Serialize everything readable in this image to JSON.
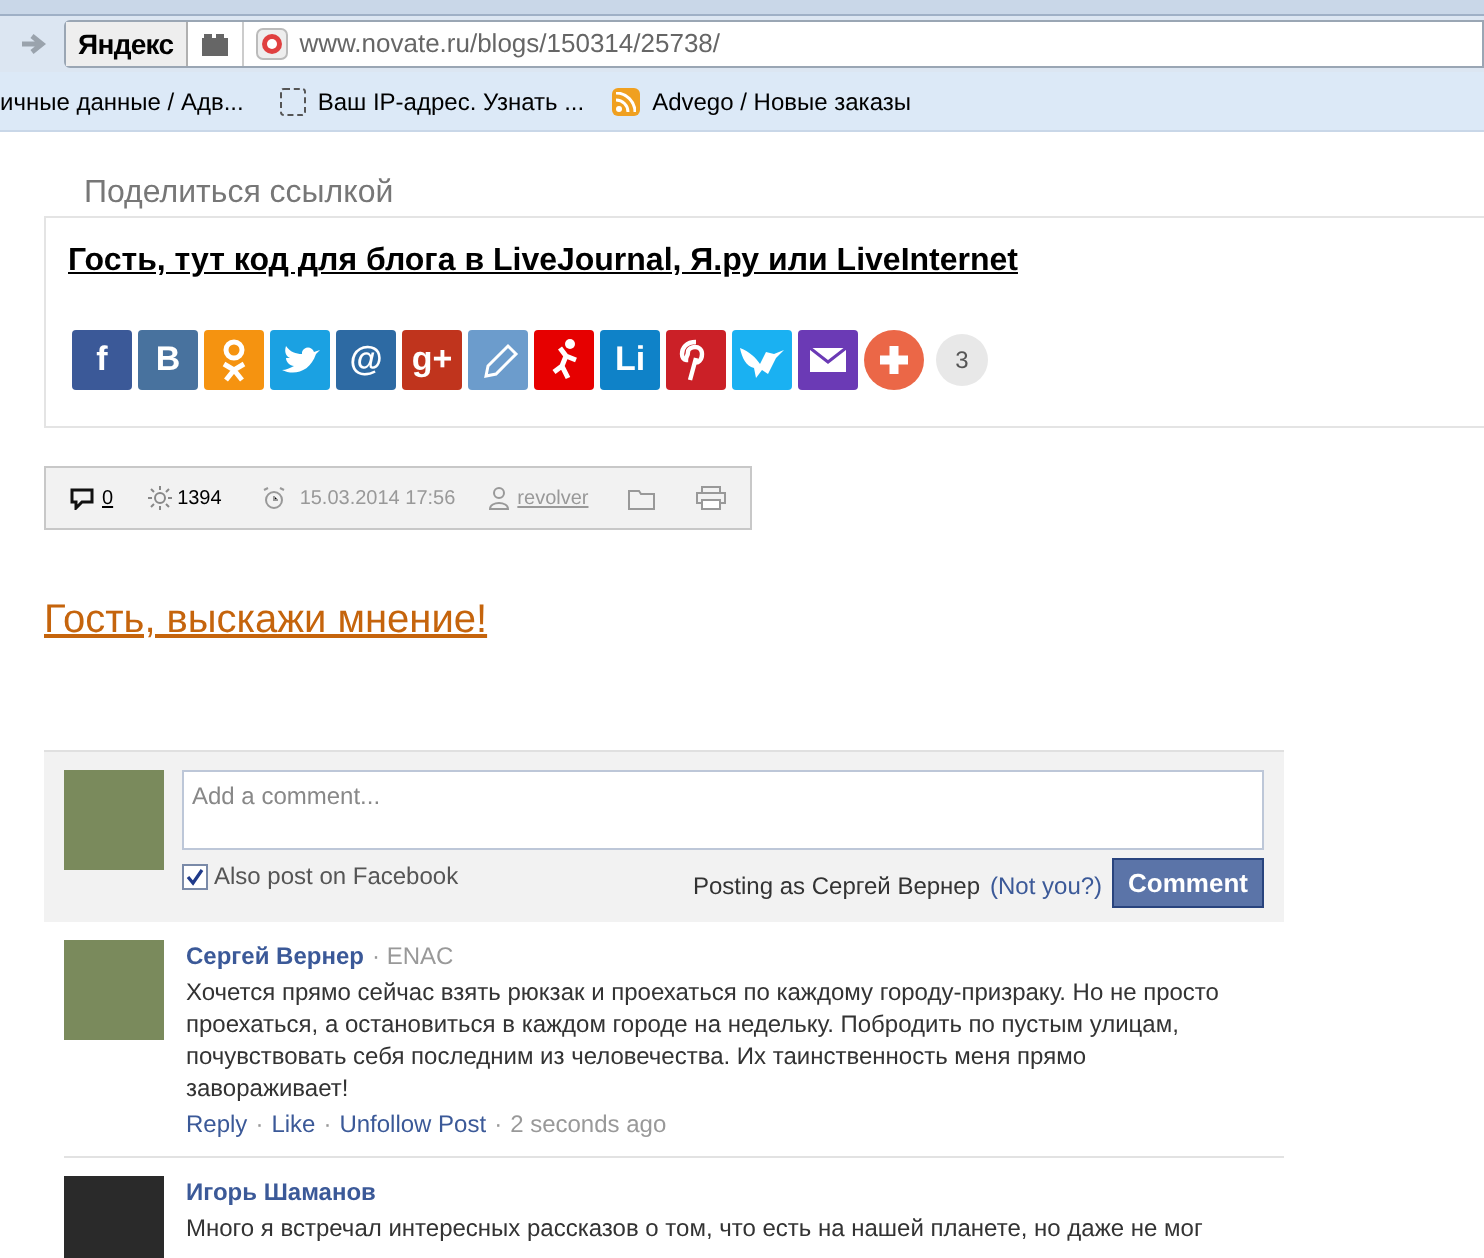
{
  "browser": {
    "search_button": "Яндекс",
    "url": "www.novate.ru/blogs/150314/25738/",
    "bookmarks": [
      {
        "label": "ичные данные / Адв...",
        "kind": "none"
      },
      {
        "label": "Ваш IP-адрес. Узнать ...",
        "kind": "page"
      },
      {
        "label": "Advego / Новые заказы",
        "kind": "feed"
      }
    ]
  },
  "share": {
    "heading": "Поделиться ссылкой",
    "title": "Гость, тут код для блога в LiveJournal, Я.ру или LiveInternet",
    "buttons": [
      {
        "kind": "letter",
        "label": "f",
        "color": "#3b5998"
      },
      {
        "kind": "letter",
        "label": "В",
        "color": "#48729e"
      },
      {
        "kind": "ok",
        "color": "#f59310"
      },
      {
        "kind": "bird",
        "color": "#1ba1e2"
      },
      {
        "kind": "letter",
        "label": "@",
        "color": "#2d6aa3"
      },
      {
        "kind": "letter",
        "label": "g+",
        "color": "#c0341d"
      },
      {
        "kind": "pencil",
        "color": "#6c9ccc"
      },
      {
        "kind": "runner",
        "color": "#e60000"
      },
      {
        "kind": "letter",
        "label": "Li",
        "color": "#0f82c8"
      },
      {
        "kind": "pin",
        "color": "#cb2027"
      },
      {
        "kind": "swallow",
        "color": "#1ab1f2"
      },
      {
        "kind": "mail",
        "color": "#6b3ab5"
      },
      {
        "kind": "plus",
        "color": "#eb6747"
      }
    ],
    "count": "3"
  },
  "meta": {
    "comments": "0",
    "views": "1394",
    "date": "15.03.2014 17:56",
    "author": "revolver"
  },
  "call_to_action": "Гость, выскажи мнение!",
  "comment_form": {
    "placeholder": "Add a comment...",
    "also_post": {
      "label": "Also post on Facebook",
      "checked": true
    },
    "posting_as": "Posting as Сергей Вернер",
    "not_you": "(Not you?)",
    "button": "Comment"
  },
  "comments": [
    {
      "author": "Сергей Вернер",
      "affiliation": "· ENAC",
      "text": "Хочется прямо сейчас взять рюкзак и проехаться по каждому городу-призраку. Но не просто проехаться, а остановиться в каждом городе на недельку. Побродить по пустым улицам, почувствовать себя последним из человечества. Их таинственность меня прямо завораживает!",
      "actions": [
        "Reply",
        "Like",
        "Unfollow Post"
      ],
      "separator": "·",
      "time": "2 seconds ago"
    },
    {
      "author": "Игорь Шаманов",
      "text": "Много я встречал интересных рассказов о том, что есть на нашей планете, но даже не мог"
    }
  ]
}
